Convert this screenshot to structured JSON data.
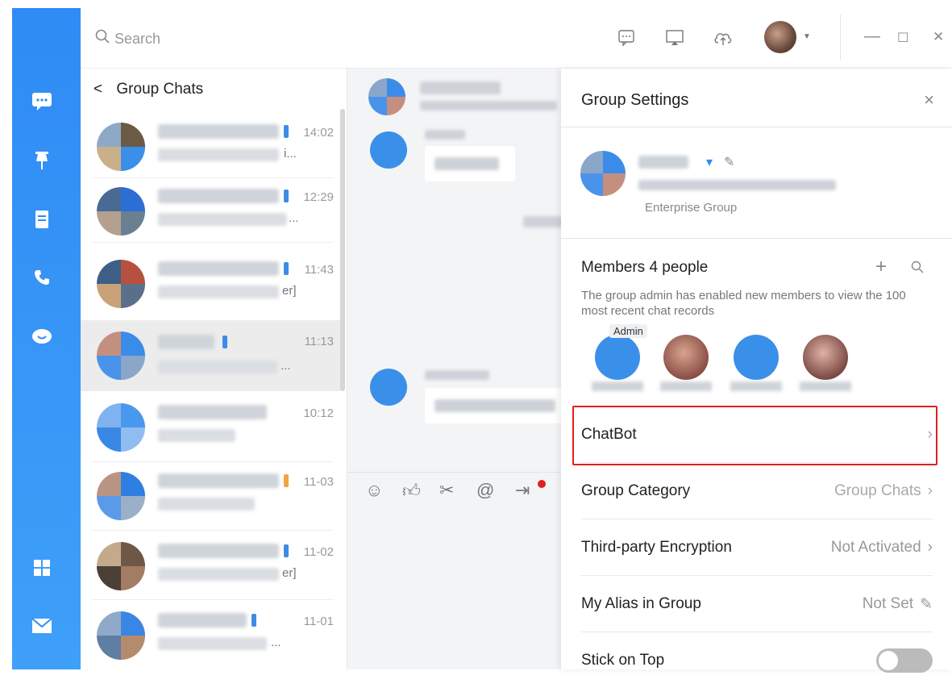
{
  "search": {
    "placeholder": "Search"
  },
  "nav_icons": [
    "chat-icon",
    "pin-icon",
    "contacts-icon",
    "phone-icon",
    "cloud-icon",
    "apps-icon",
    "mail-icon"
  ],
  "window_controls": {
    "minimize": "—",
    "maximize": "☐",
    "close": "✕"
  },
  "chat_list": {
    "back_label": "<",
    "title": "Group Chats",
    "items": [
      {
        "time": "14:02",
        "preview_tail": "i..."
      },
      {
        "time": "12:29",
        "preview_tail": "..."
      },
      {
        "time": "11:43",
        "preview_tail": "er]"
      },
      {
        "time": "11:13",
        "preview_tail": "..."
      },
      {
        "time": "10:12",
        "preview_tail": ""
      },
      {
        "time": "11-03",
        "preview_tail": ""
      },
      {
        "time": "11-02",
        "preview_tail": "er]"
      },
      {
        "time": "11-01",
        "preview_tail": "..."
      }
    ]
  },
  "settings": {
    "title": "Group Settings",
    "close": "×",
    "group_type": "Enterprise Group",
    "members_label": "Members 4 people",
    "members_note": "The group admin has enabled new members to view the 100 most recent chat records",
    "admin_badge": "Admin",
    "rows": [
      {
        "label": "ChatBot",
        "value": "",
        "arrow": "›"
      },
      {
        "label": "Group Category",
        "value": "Group Chats",
        "arrow": "›"
      },
      {
        "label": "Third-party Encryption",
        "value": "Not Activated",
        "arrow": "›"
      },
      {
        "label": "My Alias in Group",
        "value": "Not Set",
        "arrow": "✎"
      },
      {
        "label": "Stick on Top",
        "value": "",
        "arrow": ""
      }
    ]
  },
  "colors": {
    "accent": "#2f8bf5",
    "highlight": "#e02020"
  }
}
